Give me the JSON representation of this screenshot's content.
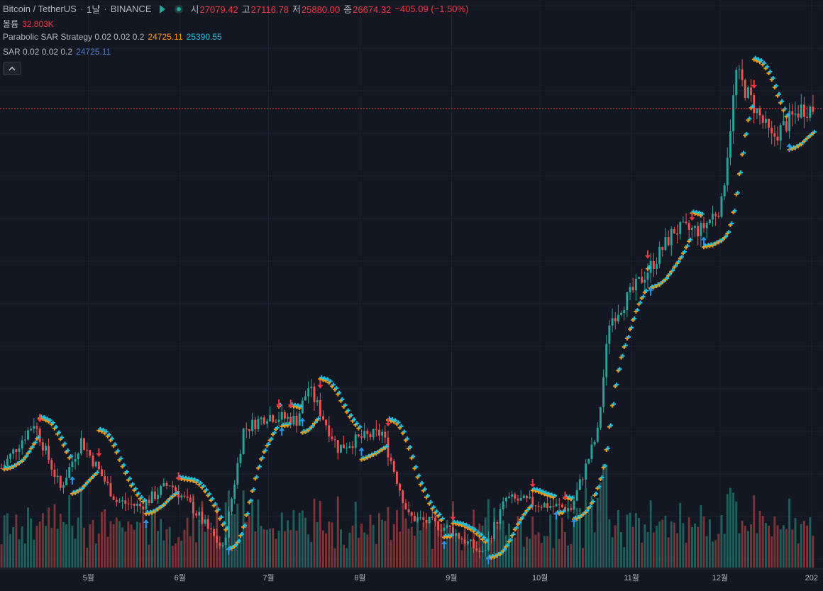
{
  "header": {
    "symbol": "Bitcoin / TetherUS",
    "interval": "1날",
    "exchange": "BINANCE",
    "ohlc": {
      "open_label": "시",
      "open": "27079.42",
      "high_label": "고",
      "high": "27116.78",
      "low_label": "저",
      "low": "25880.00",
      "close_label": "종",
      "close": "26674.32",
      "change": "−405.09 (−1.50%)"
    }
  },
  "volume_legend": {
    "label": "볼륨",
    "value": "32.803K"
  },
  "strategy_legend": {
    "label": "Parabolic SAR Strategy 0.02 0.02 0.2",
    "value1": "24725.11",
    "value2": "25390.55"
  },
  "sar_legend": {
    "label": "SAR 0.02 0.02 0.2",
    "value": "24725.11"
  },
  "collapse_icon": "chevron-up-icon",
  "colors": {
    "background": "#131722",
    "grid": "#1f2331",
    "up": "#26a69a",
    "down": "#ef5350",
    "sar_orange": "#ff9800",
    "sar_cyan": "#22c1dc",
    "buy_arrow": "#2196f3",
    "sell_arrow": "#f23645",
    "price_line": "#f23645"
  },
  "chart_data": {
    "type": "candlestick",
    "symbol": "BTCUSDT",
    "x_tick_labels": [
      "5월",
      "6월",
      "7월",
      "8월",
      "9월",
      "10월",
      "11월",
      "12월",
      "202"
    ],
    "x_range": [
      "2023-04-01",
      "2024-01-02"
    ],
    "y_range": [
      26300,
      45200
    ],
    "last_price": 42600,
    "price_segments": [
      [
        "2023-04-01",
        28400
      ],
      [
        "2023-04-12",
        30200
      ],
      [
        "2023-04-21",
        27600
      ],
      [
        "2023-04-28",
        29500
      ],
      [
        "2023-05-10",
        27100
      ],
      [
        "2023-05-18",
        26900
      ],
      [
        "2023-05-28",
        27800
      ],
      [
        "2023-06-05",
        26800
      ],
      [
        "2023-06-15",
        25200
      ],
      [
        "2023-06-22",
        29900
      ],
      [
        "2023-06-30",
        30500
      ],
      [
        "2023-07-10",
        30300
      ],
      [
        "2023-07-14",
        31600
      ],
      [
        "2023-07-24",
        29200
      ],
      [
        "2023-08-01",
        29600
      ],
      [
        "2023-08-08",
        29800
      ],
      [
        "2023-08-17",
        26500
      ],
      [
        "2023-08-31",
        26000
      ],
      [
        "2023-09-11",
        25000
      ],
      [
        "2023-09-19",
        27200
      ],
      [
        "2023-09-30",
        27000
      ],
      [
        "2023-10-11",
        26800
      ],
      [
        "2023-10-20",
        29800
      ],
      [
        "2023-10-24",
        34200
      ],
      [
        "2023-11-01",
        35400
      ],
      [
        "2023-11-09",
        36700
      ],
      [
        "2023-11-15",
        37800
      ],
      [
        "2023-11-24",
        37800
      ],
      [
        "2023-12-01",
        38800
      ],
      [
        "2023-12-06",
        44000
      ],
      [
        "2023-12-18",
        41400
      ],
      [
        "2023-12-28",
        42600
      ],
      [
        "2024-01-02",
        42600
      ]
    ],
    "volume_range": [
      0,
      160000
    ]
  }
}
